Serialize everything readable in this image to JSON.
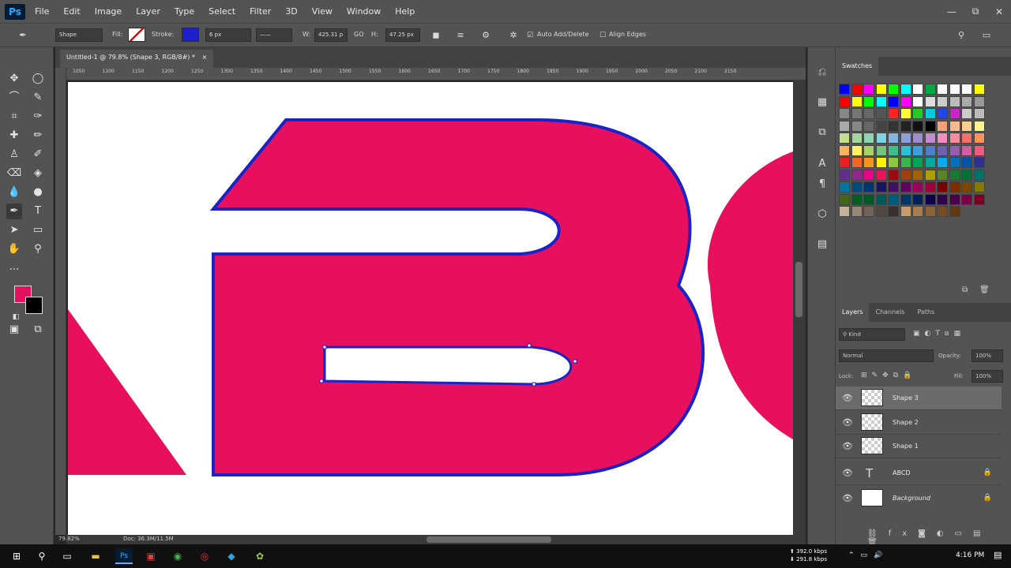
{
  "app": {
    "logo": "Ps"
  },
  "menu": [
    "File",
    "Edit",
    "Image",
    "Layer",
    "Type",
    "Select",
    "Filter",
    "3D",
    "View",
    "Window",
    "Help"
  ],
  "window_controls": {
    "minimize": "—",
    "restore": "⧉",
    "close": "✕"
  },
  "options_bar": {
    "mode": "Shape",
    "fill_label": "Fill:",
    "stroke_label": "Stroke:",
    "stroke_width": "6 px",
    "w_label": "W:",
    "w_value": "425.31 p",
    "link_icon": "GO",
    "h_label": "H:",
    "h_value": "47.25 px",
    "auto_add_delete": "Auto Add/Delete",
    "align_edges": "Align Edges",
    "stroke_color": "#1f1fd0"
  },
  "document": {
    "tab_title": "Untitled-1 @ 79.8% (Shape 3, RGB/8#) *",
    "tab_close": "×",
    "zoom": "79.82%",
    "doc_size": "Doc: 36.3M/11.5M",
    "ruler_labels": [
      "1050",
      "1100",
      "1150",
      "1200",
      "1250",
      "1300",
      "1350",
      "1400",
      "1450",
      "1500",
      "1550",
      "1600",
      "1650",
      "1700",
      "1750",
      "1800",
      "1850",
      "1900",
      "1950",
      "2000",
      "2050",
      "2100",
      "2150"
    ],
    "shape_fill": "#e8105e",
    "shape_stroke": "#1a23c8"
  },
  "tools": {
    "foreground_color": "#e8105e",
    "background_color": "#000000"
  },
  "swatches_panel": {
    "title": "Swatches",
    "colors": [
      "#0000ff",
      "#ff0000",
      "#ff00ff",
      "#ffff00",
      "#00ff00",
      "#00ffff",
      "#ffffff",
      "#00aa44",
      "#ffffff",
      "#ffffff",
      "#ffffff",
      "#ffff00",
      "#ff0000",
      "#ffff00",
      "#00ff00",
      "#00ffff",
      "#0000ff",
      "#ff00ff",
      "#ffffff",
      "#dddddd",
      "#cccccc",
      "#bbbbbb",
      "#aaaaaa",
      "#999999",
      "#888888",
      "#777777",
      "#666666",
      "#555555",
      "#ff2222",
      "#ffff33",
      "#22cc22",
      "#00ccdd",
      "#2244ee",
      "#cc22cc",
      "#cccccc",
      "#bbbbbb",
      "#aaaaaa",
      "#888888",
      "#666666",
      "#444444",
      "#333333",
      "#222222",
      "#111111",
      "#000000",
      "#f4a07a",
      "#f9b98b",
      "#fbd08f",
      "#fef291",
      "#c2e08e",
      "#a2d5a0",
      "#8fd3b2",
      "#7fd3e3",
      "#84b4e3",
      "#8e9fd8",
      "#9f8ccc",
      "#c18fcc",
      "#f08fbf",
      "#f48ca0",
      "#f2706a",
      "#f7945e",
      "#fbb45c",
      "#fff25e",
      "#aad163",
      "#74c37c",
      "#3fbd8f",
      "#2dbfd6",
      "#3f9fdc",
      "#4d7fcc",
      "#6b5fb6",
      "#965db3",
      "#d45ea3",
      "#ef5b7f",
      "#ee1c24",
      "#f26522",
      "#f7941d",
      "#fff200",
      "#8dc63f",
      "#39b54a",
      "#00a651",
      "#00a99d",
      "#00aeef",
      "#0072bc",
      "#0054a6",
      "#2e3192",
      "#662d91",
      "#92278f",
      "#ec008c",
      "#ed145b",
      "#9e0b0f",
      "#a0410d",
      "#a36209",
      "#aba000",
      "#598527",
      "#197b30",
      "#007236",
      "#00746b",
      "#0076a3",
      "#004a80",
      "#003471",
      "#1b1464",
      "#440e62",
      "#630460",
      "#9e005d",
      "#9e0039",
      "#790000",
      "#7b2e00",
      "#7d4900",
      "#827b00",
      "#406618",
      "#005e20",
      "#005826",
      "#005952",
      "#005b7f",
      "#003663",
      "#002157",
      "#0d004c",
      "#32004b",
      "#4b0049",
      "#7b0046",
      "#7a0026",
      "#c7b299",
      "#998675",
      "#736357",
      "#534741",
      "#37302d",
      "#c69c6d",
      "#a67c52",
      "#8c6239",
      "#754c24",
      "#603913"
    ]
  },
  "layers_panel": {
    "tabs": [
      "Layers",
      "Channels",
      "Paths"
    ],
    "kind_label": "Kind",
    "blend_mode": "Normal",
    "opacity_label": "Opacity:",
    "opacity_value": "100%",
    "lock_label": "Lock:",
    "fill_label": "Fill:",
    "fill_value": "100%",
    "layers": [
      {
        "name": "Shape 3",
        "type": "shape",
        "selected": true
      },
      {
        "name": "Shape 2",
        "type": "shape",
        "selected": false
      },
      {
        "name": "Shape 1",
        "type": "shape",
        "selected": false
      },
      {
        "name": "ABCD",
        "type": "text",
        "selected": false
      },
      {
        "name": "Background",
        "type": "background",
        "selected": false
      }
    ]
  },
  "taskbar": {
    "upload_speed": "392.0 kbps",
    "download_speed": "291.8 kbps",
    "time": "4:16 PM"
  }
}
